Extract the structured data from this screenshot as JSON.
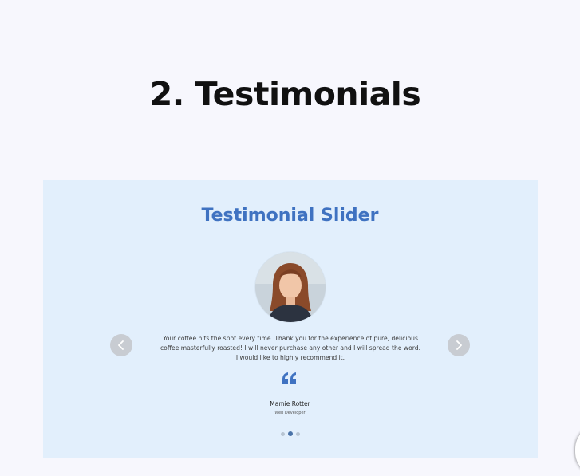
{
  "page": {
    "heading": "2. Testimonials"
  },
  "slider": {
    "title": "Testimonial Slider",
    "testimonial": {
      "text": "Your coffee hits the spot every time. Thank you for the experience of pure, delicious coffee masterfully roasted! I will never purchase any other and I will spread the word. I would like to highly recommend it.",
      "author_name": "Mamie Rotter",
      "author_role": "Web Developer"
    },
    "nav": {
      "prev_icon": "chevron-left-icon",
      "next_icon": "chevron-right-icon"
    },
    "quote_icon": "quote-icon",
    "pagination": {
      "total": 3,
      "active_index": 1
    },
    "colors": {
      "title": "#3f72c1",
      "panel_background": "#e2effc",
      "active_dot": "#4a73a8",
      "arrow_background": "#c8ccd2"
    }
  }
}
